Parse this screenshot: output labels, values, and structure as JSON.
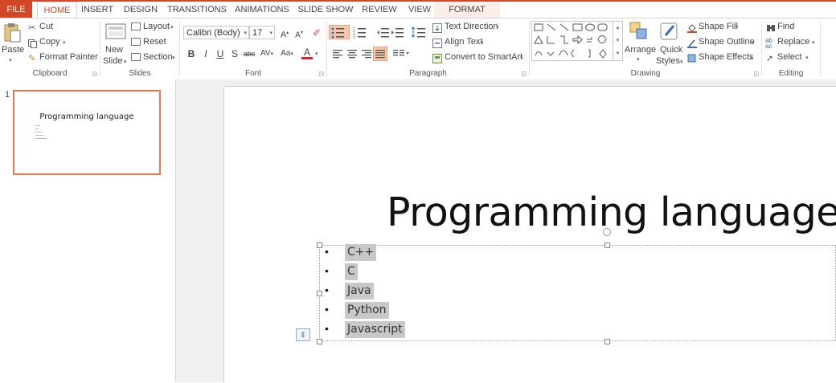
{
  "tabs": [
    "FILE",
    "HOME",
    "INSERT",
    "DESIGN",
    "TRANSITIONS",
    "ANIMATIONS",
    "SLIDE SHOW",
    "REVIEW",
    "VIEW",
    "FORMAT"
  ],
  "clipboard": {
    "paste": "Paste",
    "cut": "Cut",
    "copy": "Copy",
    "format_painter": "Format Painter",
    "label": "Clipboard"
  },
  "slides": {
    "new_slide_1": "New",
    "new_slide_2": "Slide",
    "layout": "Layout",
    "reset": "Reset",
    "section": "Section",
    "label": "Slides"
  },
  "font": {
    "name": "Calibri (Body)",
    "size": "17",
    "label": "Font"
  },
  "paragraph": {
    "text_direction": "Text Direction",
    "align_text": "Align Text",
    "smartart": "Convert to SmartArt",
    "label": "Paragraph"
  },
  "drawing": {
    "arrange": "Arrange",
    "quick_1": "Quick",
    "quick_2": "Styles",
    "shape_fill": "Shape Fill",
    "shape_outline": "Shape Outline",
    "shape_effects": "Shape Effects",
    "label": "Drawing"
  },
  "editing": {
    "find": "Find",
    "replace": "Replace",
    "select": "Select",
    "label": "Editing"
  },
  "thumb": {
    "number": "1",
    "title": "Programming language"
  },
  "slide": {
    "title": "Programming language",
    "bullets": [
      "C++",
      "C",
      "Java",
      "Python",
      "Javascript"
    ]
  },
  "colors": {
    "accent": "#d24726",
    "selection": "#c8c8c8"
  }
}
